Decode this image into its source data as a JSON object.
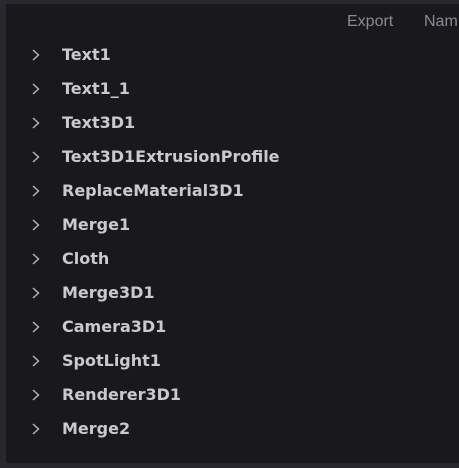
{
  "header": {
    "export_label": "Export",
    "name_label": "Nam"
  },
  "tree": {
    "expander_icon": "chevron-right-icon",
    "items": [
      {
        "label": "Text1"
      },
      {
        "label": "Text1_1"
      },
      {
        "label": "Text3D1"
      },
      {
        "label": "Text3D1ExtrusionProfile"
      },
      {
        "label": "ReplaceMaterial3D1"
      },
      {
        "label": "Merge1"
      },
      {
        "label": "Cloth"
      },
      {
        "label": "Merge3D1"
      },
      {
        "label": "Camera3D1"
      },
      {
        "label": "SpotLight1"
      },
      {
        "label": "Renderer3D1"
      },
      {
        "label": "Merge2"
      }
    ]
  },
  "colors": {
    "frame": "#28282e",
    "panel": "#19191d",
    "text": "#c9c9cf",
    "header_text": "#8a8a93"
  }
}
